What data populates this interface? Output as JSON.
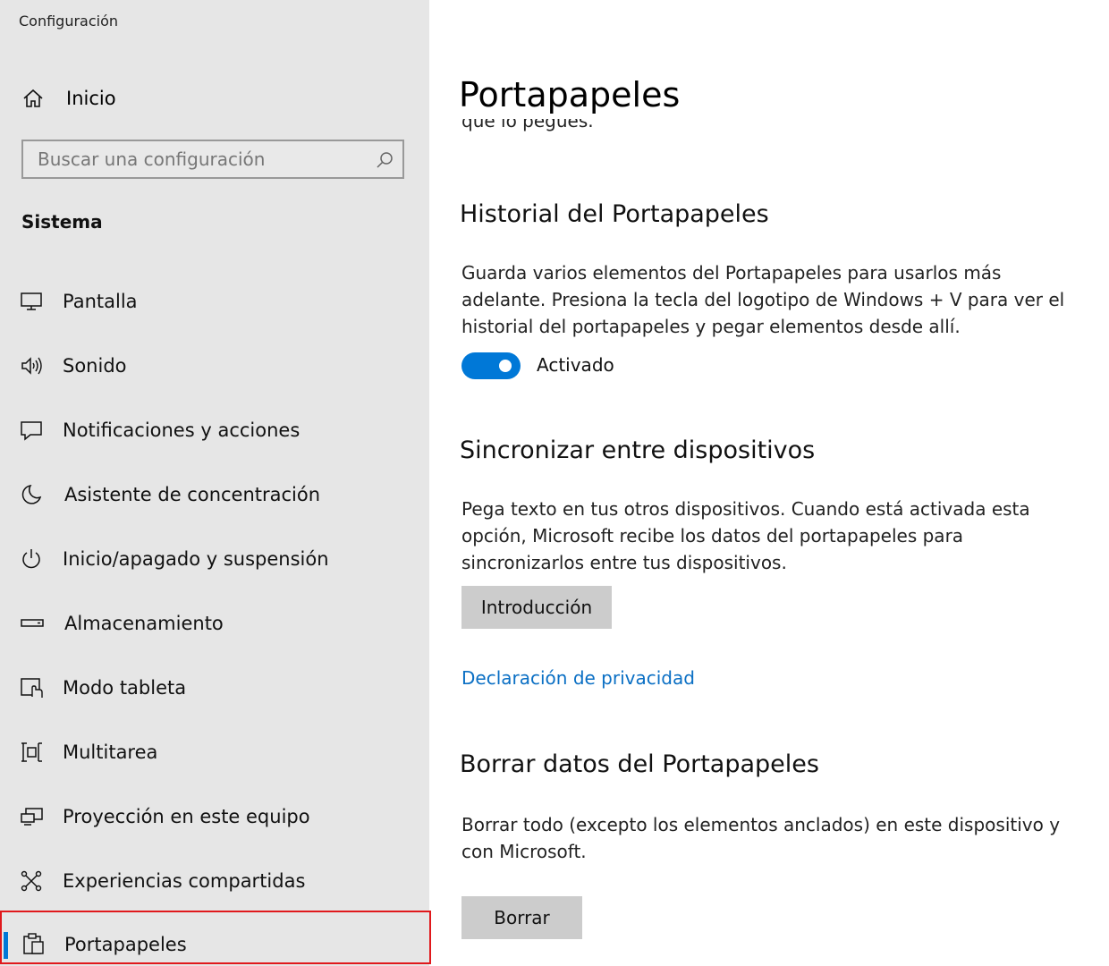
{
  "app": {
    "title": "Configuración"
  },
  "sidebar": {
    "home_label": "Inicio",
    "search_placeholder": "Buscar una configuración",
    "section_label": "Sistema",
    "items": [
      {
        "label": "Pantalla",
        "icon": "monitor-icon"
      },
      {
        "label": "Sonido",
        "icon": "speaker-icon"
      },
      {
        "label": "Notificaciones y acciones",
        "icon": "notification-icon"
      },
      {
        "label": "Asistente de concentración",
        "icon": "moon-icon"
      },
      {
        "label": "Inicio/apagado y suspensión",
        "icon": "power-icon"
      },
      {
        "label": "Almacenamiento",
        "icon": "storage-icon"
      },
      {
        "label": "Modo tableta",
        "icon": "tablet-mode-icon"
      },
      {
        "label": "Multitarea",
        "icon": "multitask-icon"
      },
      {
        "label": "Proyección en este equipo",
        "icon": "projection-icon"
      },
      {
        "label": "Experiencias compartidas",
        "icon": "shared-experiences-icon"
      },
      {
        "label": "Portapapeles",
        "icon": "clipboard-icon",
        "active": true
      }
    ]
  },
  "main": {
    "title": "Portapapeles",
    "cut_text": "que lo pegues.",
    "history": {
      "heading": "Historial del Portapapeles",
      "description": "Guarda varios elementos del Portapapeles para usarlos más adelante. Presiona la tecla del logotipo de Windows + V para ver el historial del portapapeles y pegar elementos desde allí.",
      "toggle_state": "Activado",
      "toggle_on": true
    },
    "sync": {
      "heading": "Sincronizar entre dispositivos",
      "description": "Pega texto en tus otros dispositivos. Cuando está activada esta opción, Microsoft recibe los datos del portapapeles para sincronizarlos entre tus dispositivos.",
      "button_label": "Introducción"
    },
    "privacy_link": "Declaración de privacidad",
    "clear": {
      "heading": "Borrar datos del Portapapeles",
      "description": "Borrar todo (excepto los elementos anclados) en este dispositivo y con Microsoft.",
      "button_label": "Borrar"
    }
  },
  "colors": {
    "accent": "#0078d7",
    "link": "#0a6fc4",
    "highlight_box": "#e0191c",
    "sidebar_bg": "#e6e6e6"
  }
}
